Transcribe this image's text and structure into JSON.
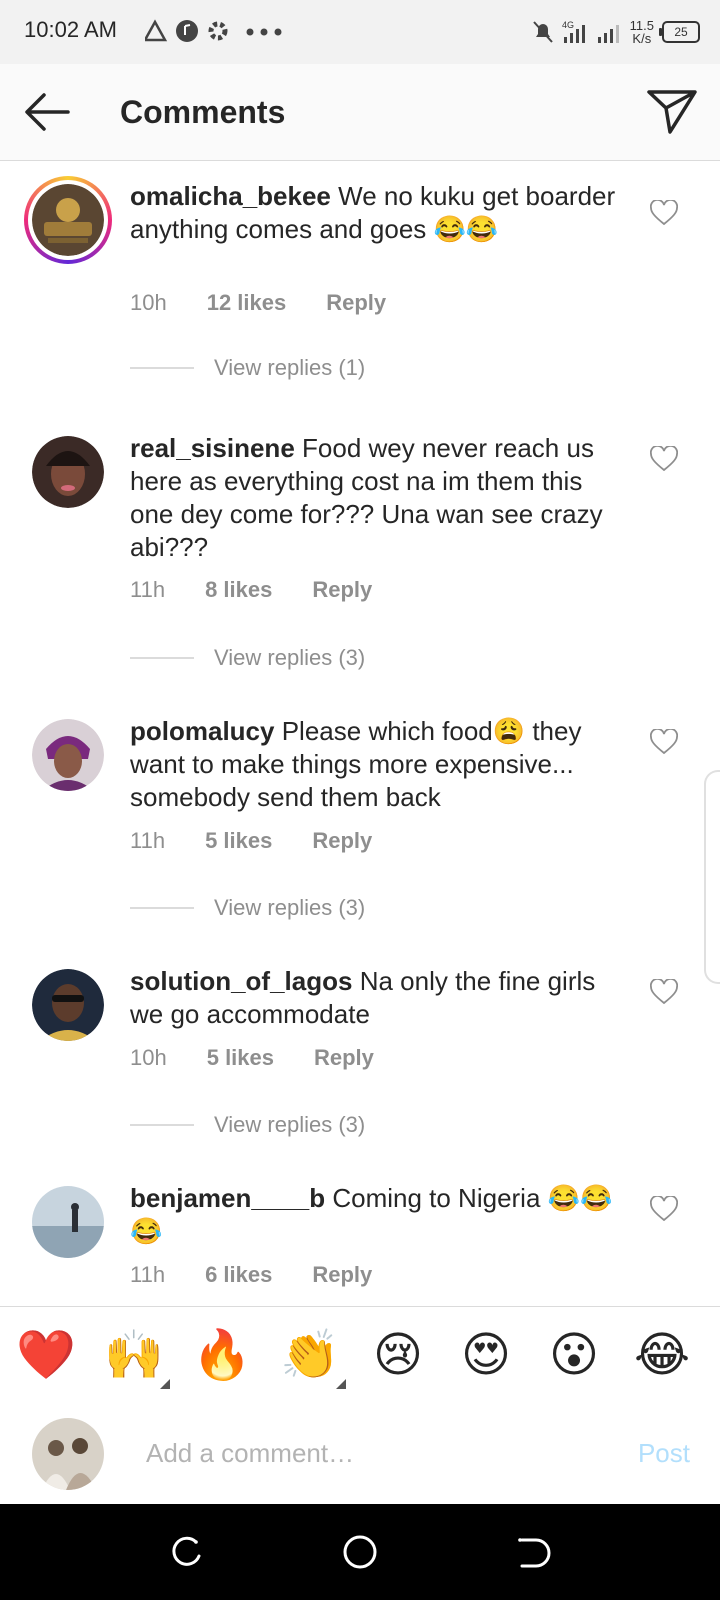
{
  "status_bar": {
    "time": "10:02 AM",
    "network_speed": "11.5",
    "network_unit": "K/s",
    "signal_type": "4G",
    "battery": "25"
  },
  "header": {
    "title": "Comments"
  },
  "comments": [
    {
      "username": "omalicha_bekee",
      "text": "We no kuku get boarder anything comes and goes 😂😂",
      "time": "10h",
      "likes": "12 likes",
      "reply": "Reply",
      "view_replies": "View replies (1)",
      "avatar_color": "#5a4632",
      "has_story_ring": true
    },
    {
      "username": "real_sisinene",
      "text": "Food wey never reach us here as everything cost na im them this one dey come for??? Una wan see crazy abi???",
      "time": "11h",
      "likes": "8 likes",
      "reply": "Reply",
      "view_replies": "View replies (3)",
      "avatar_color": "#3b2a26"
    },
    {
      "username": "polomalucy",
      "text": "Please which food😩 they want to make things more expensive... somebody send them back",
      "time": "11h",
      "likes": "5 likes",
      "reply": "Reply",
      "view_replies": "View replies (3)",
      "avatar_color": "#6a2e6e"
    },
    {
      "username": "solution_of_lagos",
      "text": "Na only the fine girls we go accommodate",
      "time": "10h",
      "likes": "5 likes",
      "reply": "Reply",
      "view_replies": "View replies (3)",
      "avatar_color": "#1f2a3c"
    },
    {
      "username": "benjamen____b",
      "text": "Coming to Nigeria 😂😂😂",
      "time": "11h",
      "likes": "6 likes",
      "reply": "Reply",
      "avatar_color": "#9fb3c4"
    }
  ],
  "quick_emojis": [
    "❤️",
    "🙌",
    "🔥",
    "👏",
    "😢",
    "😍",
    "😮",
    "😂"
  ],
  "composer": {
    "placeholder": "Add a comment…",
    "post_label": "Post"
  },
  "colors": {
    "accent": "#0095f6",
    "post_disabled": "#b2dffc",
    "muted": "#8e8e8e"
  }
}
